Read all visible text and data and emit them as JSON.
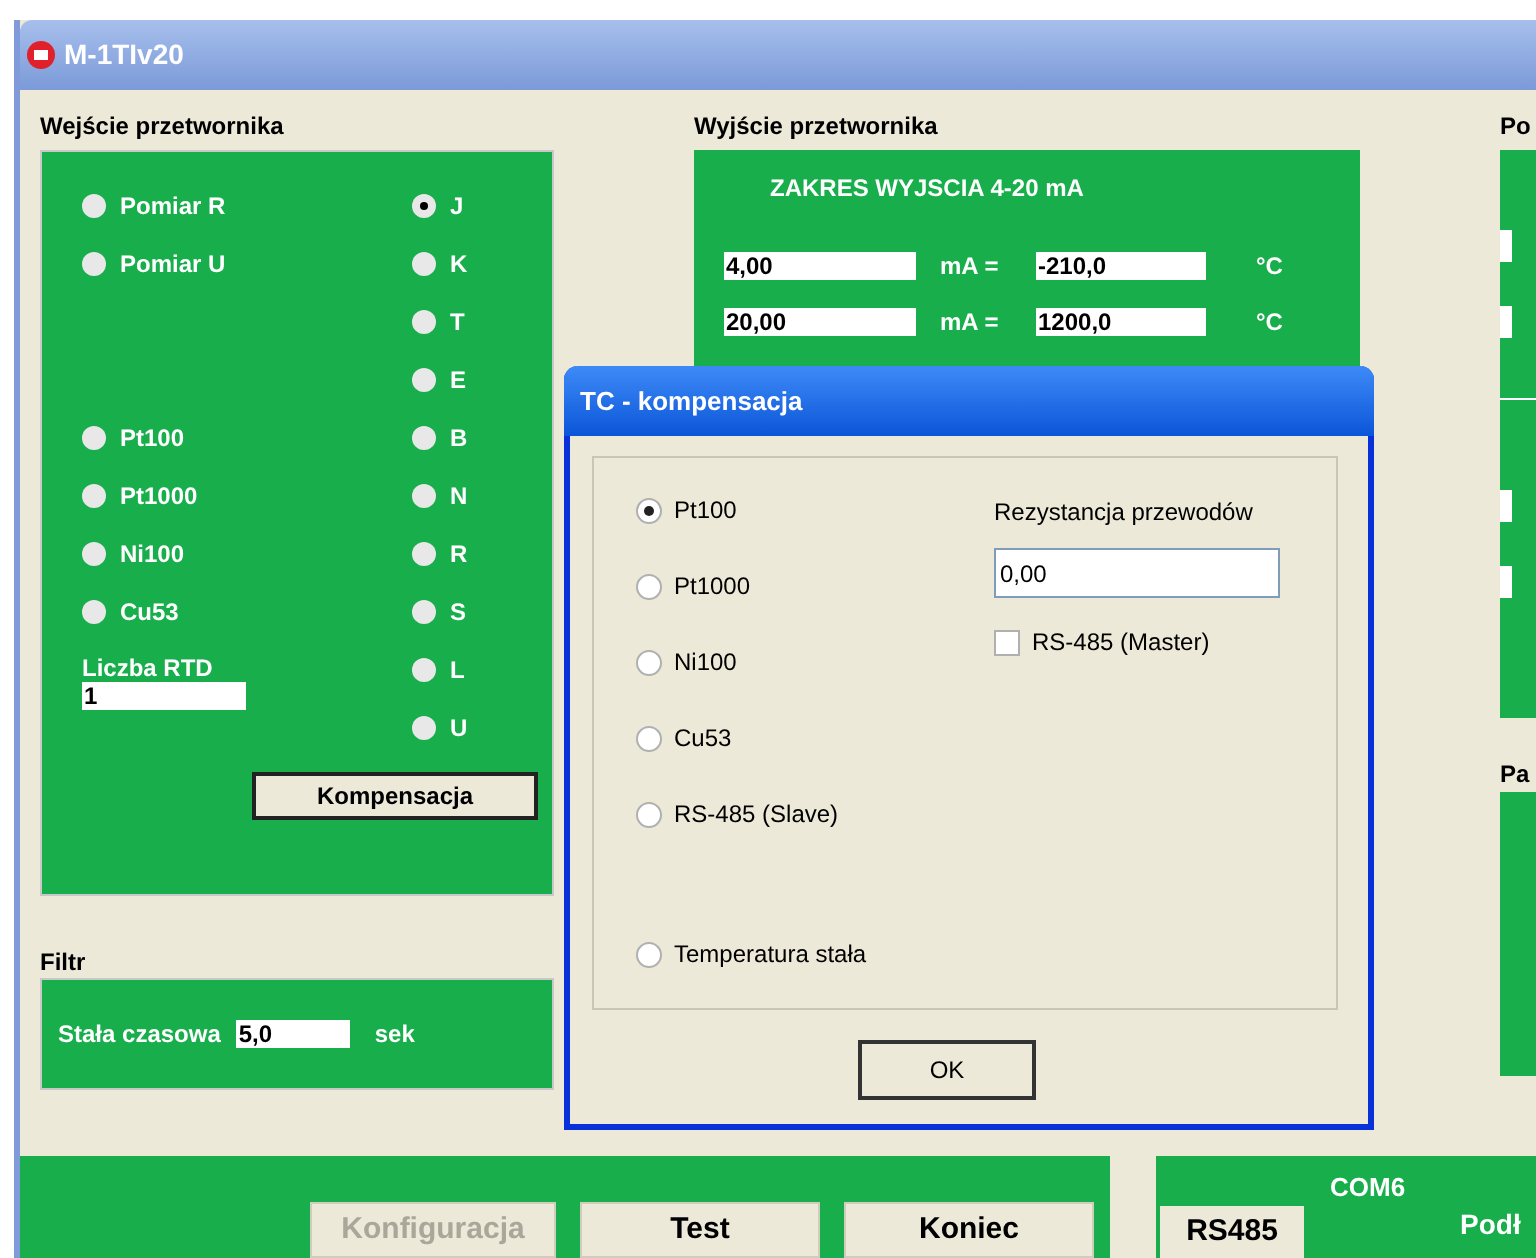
{
  "window": {
    "title": "M-1TIv20"
  },
  "input": {
    "title": "Wejście przetwornika",
    "measurement_options": [
      {
        "label": "Pomiar R",
        "selected": false
      },
      {
        "label": "Pomiar U",
        "selected": false
      }
    ],
    "sensor_options": [
      {
        "label": "Pt100",
        "selected": false
      },
      {
        "label": "Pt1000",
        "selected": false
      },
      {
        "label": "Ni100",
        "selected": false
      },
      {
        "label": "Cu53",
        "selected": false
      }
    ],
    "thermocouple_options": [
      {
        "label": "J",
        "selected": true
      },
      {
        "label": "K",
        "selected": false
      },
      {
        "label": "T",
        "selected": false
      },
      {
        "label": "E",
        "selected": false
      },
      {
        "label": "B",
        "selected": false
      },
      {
        "label": "N",
        "selected": false
      },
      {
        "label": "R",
        "selected": false
      },
      {
        "label": "S",
        "selected": false
      },
      {
        "label": "L",
        "selected": false
      },
      {
        "label": "U",
        "selected": false
      }
    ],
    "rtd_count": {
      "label": "Liczba RTD",
      "value": "1"
    },
    "compensation_button": "Kompensacja"
  },
  "filter": {
    "title": "Filtr",
    "label": "Stała czasowa",
    "value": "5,0",
    "unit": "sek"
  },
  "output": {
    "title": "Wyjście przetwornika",
    "range_label": "ZAKRES WYJSCIA 4-20 mA",
    "rows": [
      {
        "current": "4,00",
        "current_unit": "mA =",
        "temperature": "-210,0",
        "temperature_unit": "°C"
      },
      {
        "current": "20,00",
        "current_unit": "mA =",
        "temperature": "1200,0",
        "temperature_unit": "°C"
      }
    ]
  },
  "right_panels": [
    {
      "title": "Po"
    },
    {
      "title": "Pa"
    }
  ],
  "buttons": [
    {
      "label": "Konfiguracja",
      "disabled": true
    },
    {
      "label": "Test",
      "disabled": false
    },
    {
      "label": "Koniec",
      "disabled": false
    }
  ],
  "port": {
    "name": "COM6",
    "button": "RS485",
    "status": "Podł"
  },
  "dialog": {
    "title": "TC - kompensacja",
    "options": [
      {
        "label": "Pt100",
        "selected": true
      },
      {
        "label": "Pt1000",
        "selected": false
      },
      {
        "label": "Ni100",
        "selected": false
      },
      {
        "label": "Cu53",
        "selected": false
      },
      {
        "label": "RS-485 (Slave)",
        "selected": false
      },
      {
        "label": "Temperatura stała",
        "selected": false
      }
    ],
    "resistance": {
      "label": "Rezystancja przewodów",
      "value": "0,00"
    },
    "master": {
      "label": "RS-485 (Master)",
      "checked": false
    },
    "ok": "OK"
  }
}
